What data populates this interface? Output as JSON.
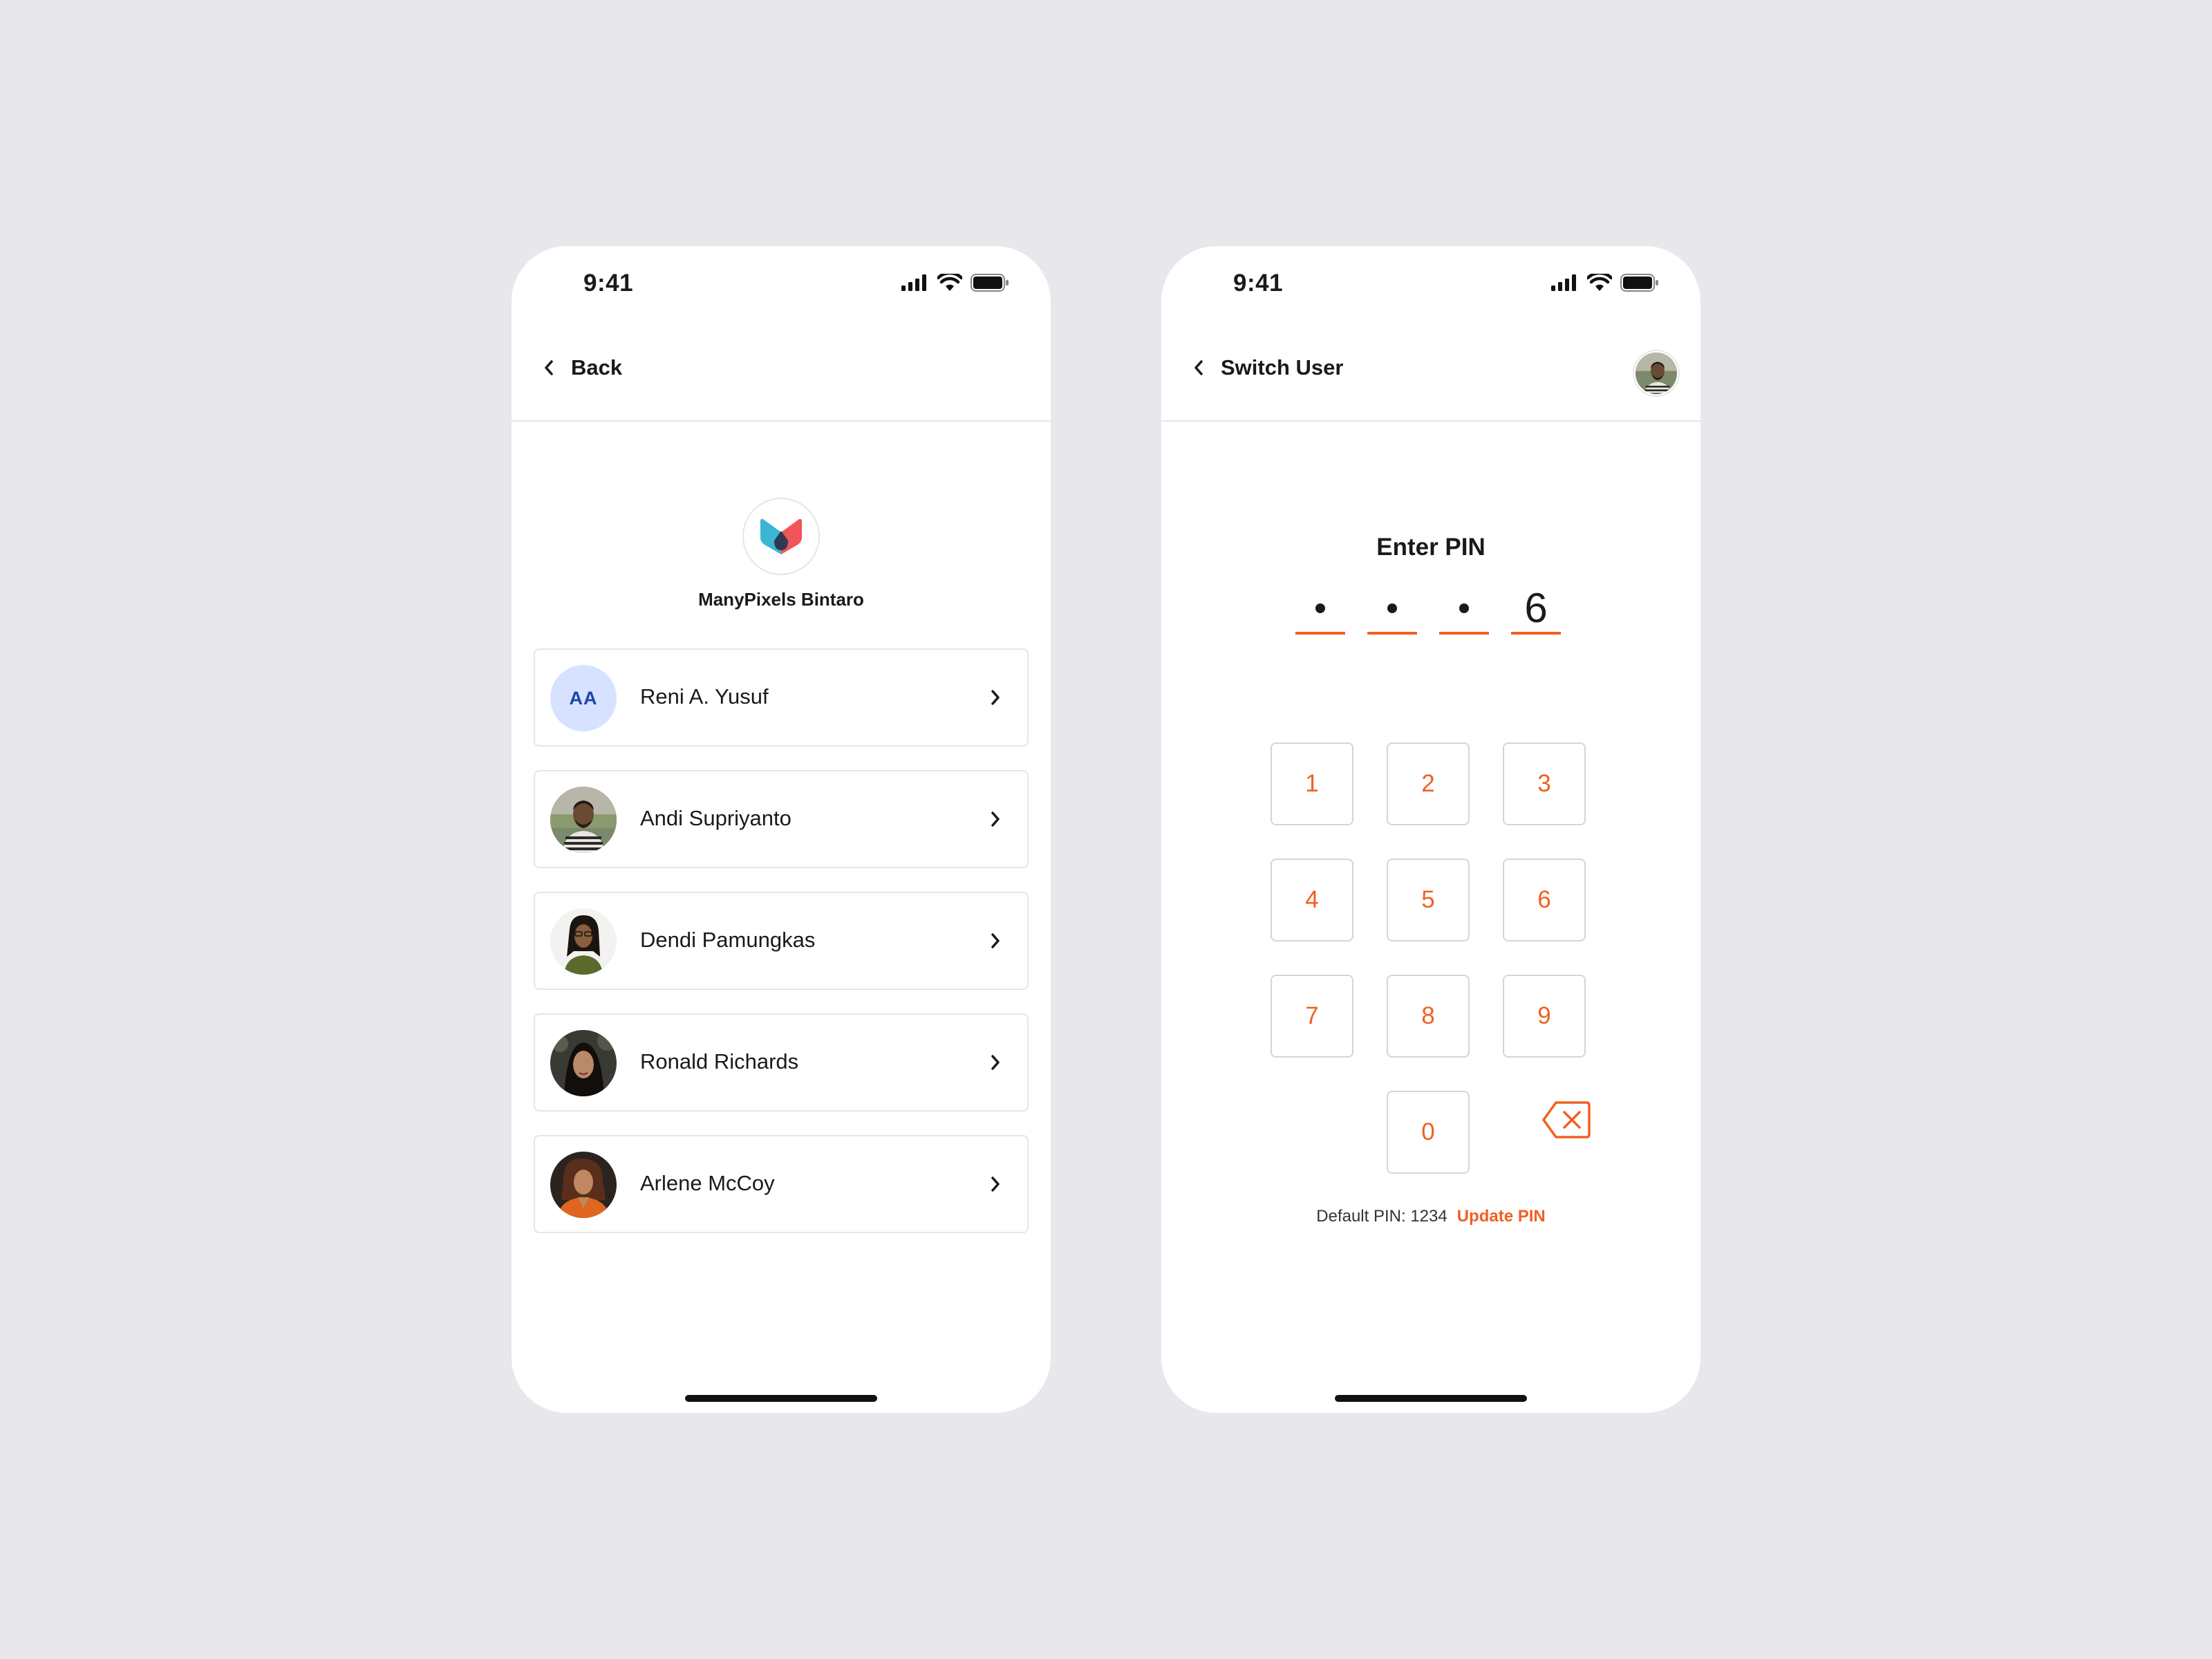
{
  "colors": {
    "background": "#E8E8EC",
    "accent": "#F06022",
    "initials_bg": "#D6E2FF",
    "initials_fg": "#1E45A8",
    "logo_teal": "#3AB6D4",
    "logo_red": "#F2545B"
  },
  "left_screen": {
    "status_time": "9:41",
    "nav": {
      "back_icon": "chevron-left-icon",
      "back_label": "Back"
    },
    "brand": {
      "logo_icon": "manypixels-logo-icon",
      "name": "ManyPixels Bintaro"
    },
    "users": [
      {
        "name": "Reni A. Yusuf",
        "initials": "AA",
        "avatar": "initials"
      },
      {
        "name": "Andi Supriyanto",
        "avatar": "photo"
      },
      {
        "name": "Dendi Pamungkas",
        "avatar": "photo"
      },
      {
        "name": "Ronald Richards",
        "avatar": "photo"
      },
      {
        "name": "Arlene McCoy",
        "avatar": "photo"
      }
    ]
  },
  "right_screen": {
    "status_time": "9:41",
    "nav": {
      "back_icon": "chevron-left-icon",
      "back_label": "Switch User",
      "avatar": "photo"
    },
    "pin": {
      "title": "Enter PIN",
      "entered": [
        "",
        "",
        "",
        "6"
      ],
      "filled_count": 4
    },
    "keypad": [
      "1",
      "2",
      "3",
      "4",
      "5",
      "6",
      "7",
      "8",
      "9",
      "0"
    ],
    "backspace_icon": "backspace-icon",
    "footer": {
      "default_pin": "Default PIN: 1234",
      "update_link": "Update PIN"
    }
  }
}
